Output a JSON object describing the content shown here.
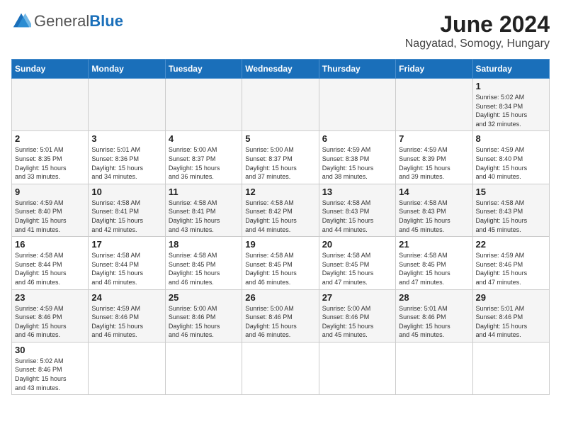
{
  "header": {
    "logo": {
      "general": "General",
      "blue": "Blue"
    },
    "title": "June 2024",
    "subtitle": "Nagyatad, Somogy, Hungary"
  },
  "weekdays": [
    "Sunday",
    "Monday",
    "Tuesday",
    "Wednesday",
    "Thursday",
    "Friday",
    "Saturday"
  ],
  "weeks": [
    [
      {
        "day": "",
        "info": ""
      },
      {
        "day": "",
        "info": ""
      },
      {
        "day": "",
        "info": ""
      },
      {
        "day": "",
        "info": ""
      },
      {
        "day": "",
        "info": ""
      },
      {
        "day": "",
        "info": ""
      },
      {
        "day": "1",
        "info": "Sunrise: 5:02 AM\nSunset: 8:34 PM\nDaylight: 15 hours\nand 32 minutes."
      }
    ],
    [
      {
        "day": "2",
        "info": "Sunrise: 5:01 AM\nSunset: 8:35 PM\nDaylight: 15 hours\nand 33 minutes."
      },
      {
        "day": "3",
        "info": "Sunrise: 5:01 AM\nSunset: 8:36 PM\nDaylight: 15 hours\nand 34 minutes."
      },
      {
        "day": "4",
        "info": "Sunrise: 5:00 AM\nSunset: 8:37 PM\nDaylight: 15 hours\nand 36 minutes."
      },
      {
        "day": "5",
        "info": "Sunrise: 5:00 AM\nSunset: 8:37 PM\nDaylight: 15 hours\nand 37 minutes."
      },
      {
        "day": "6",
        "info": "Sunrise: 4:59 AM\nSunset: 8:38 PM\nDaylight: 15 hours\nand 38 minutes."
      },
      {
        "day": "7",
        "info": "Sunrise: 4:59 AM\nSunset: 8:39 PM\nDaylight: 15 hours\nand 39 minutes."
      },
      {
        "day": "8",
        "info": "Sunrise: 4:59 AM\nSunset: 8:40 PM\nDaylight: 15 hours\nand 40 minutes."
      }
    ],
    [
      {
        "day": "9",
        "info": "Sunrise: 4:59 AM\nSunset: 8:40 PM\nDaylight: 15 hours\nand 41 minutes."
      },
      {
        "day": "10",
        "info": "Sunrise: 4:58 AM\nSunset: 8:41 PM\nDaylight: 15 hours\nand 42 minutes."
      },
      {
        "day": "11",
        "info": "Sunrise: 4:58 AM\nSunset: 8:41 PM\nDaylight: 15 hours\nand 43 minutes."
      },
      {
        "day": "12",
        "info": "Sunrise: 4:58 AM\nSunset: 8:42 PM\nDaylight: 15 hours\nand 44 minutes."
      },
      {
        "day": "13",
        "info": "Sunrise: 4:58 AM\nSunset: 8:43 PM\nDaylight: 15 hours\nand 44 minutes."
      },
      {
        "day": "14",
        "info": "Sunrise: 4:58 AM\nSunset: 8:43 PM\nDaylight: 15 hours\nand 45 minutes."
      },
      {
        "day": "15",
        "info": "Sunrise: 4:58 AM\nSunset: 8:43 PM\nDaylight: 15 hours\nand 45 minutes."
      }
    ],
    [
      {
        "day": "16",
        "info": "Sunrise: 4:58 AM\nSunset: 8:44 PM\nDaylight: 15 hours\nand 46 minutes."
      },
      {
        "day": "17",
        "info": "Sunrise: 4:58 AM\nSunset: 8:44 PM\nDaylight: 15 hours\nand 46 minutes."
      },
      {
        "day": "18",
        "info": "Sunrise: 4:58 AM\nSunset: 8:45 PM\nDaylight: 15 hours\nand 46 minutes."
      },
      {
        "day": "19",
        "info": "Sunrise: 4:58 AM\nSunset: 8:45 PM\nDaylight: 15 hours\nand 46 minutes."
      },
      {
        "day": "20",
        "info": "Sunrise: 4:58 AM\nSunset: 8:45 PM\nDaylight: 15 hours\nand 47 minutes."
      },
      {
        "day": "21",
        "info": "Sunrise: 4:58 AM\nSunset: 8:45 PM\nDaylight: 15 hours\nand 47 minutes."
      },
      {
        "day": "22",
        "info": "Sunrise: 4:59 AM\nSunset: 8:46 PM\nDaylight: 15 hours\nand 47 minutes."
      }
    ],
    [
      {
        "day": "23",
        "info": "Sunrise: 4:59 AM\nSunset: 8:46 PM\nDaylight: 15 hours\nand 46 minutes."
      },
      {
        "day": "24",
        "info": "Sunrise: 4:59 AM\nSunset: 8:46 PM\nDaylight: 15 hours\nand 46 minutes."
      },
      {
        "day": "25",
        "info": "Sunrise: 5:00 AM\nSunset: 8:46 PM\nDaylight: 15 hours\nand 46 minutes."
      },
      {
        "day": "26",
        "info": "Sunrise: 5:00 AM\nSunset: 8:46 PM\nDaylight: 15 hours\nand 46 minutes."
      },
      {
        "day": "27",
        "info": "Sunrise: 5:00 AM\nSunset: 8:46 PM\nDaylight: 15 hours\nand 45 minutes."
      },
      {
        "day": "28",
        "info": "Sunrise: 5:01 AM\nSunset: 8:46 PM\nDaylight: 15 hours\nand 45 minutes."
      },
      {
        "day": "29",
        "info": "Sunrise: 5:01 AM\nSunset: 8:46 PM\nDaylight: 15 hours\nand 44 minutes."
      }
    ],
    [
      {
        "day": "30",
        "info": "Sunrise: 5:02 AM\nSunset: 8:46 PM\nDaylight: 15 hours\nand 43 minutes."
      },
      {
        "day": "",
        "info": ""
      },
      {
        "day": "",
        "info": ""
      },
      {
        "day": "",
        "info": ""
      },
      {
        "day": "",
        "info": ""
      },
      {
        "day": "",
        "info": ""
      },
      {
        "day": "",
        "info": ""
      }
    ]
  ]
}
